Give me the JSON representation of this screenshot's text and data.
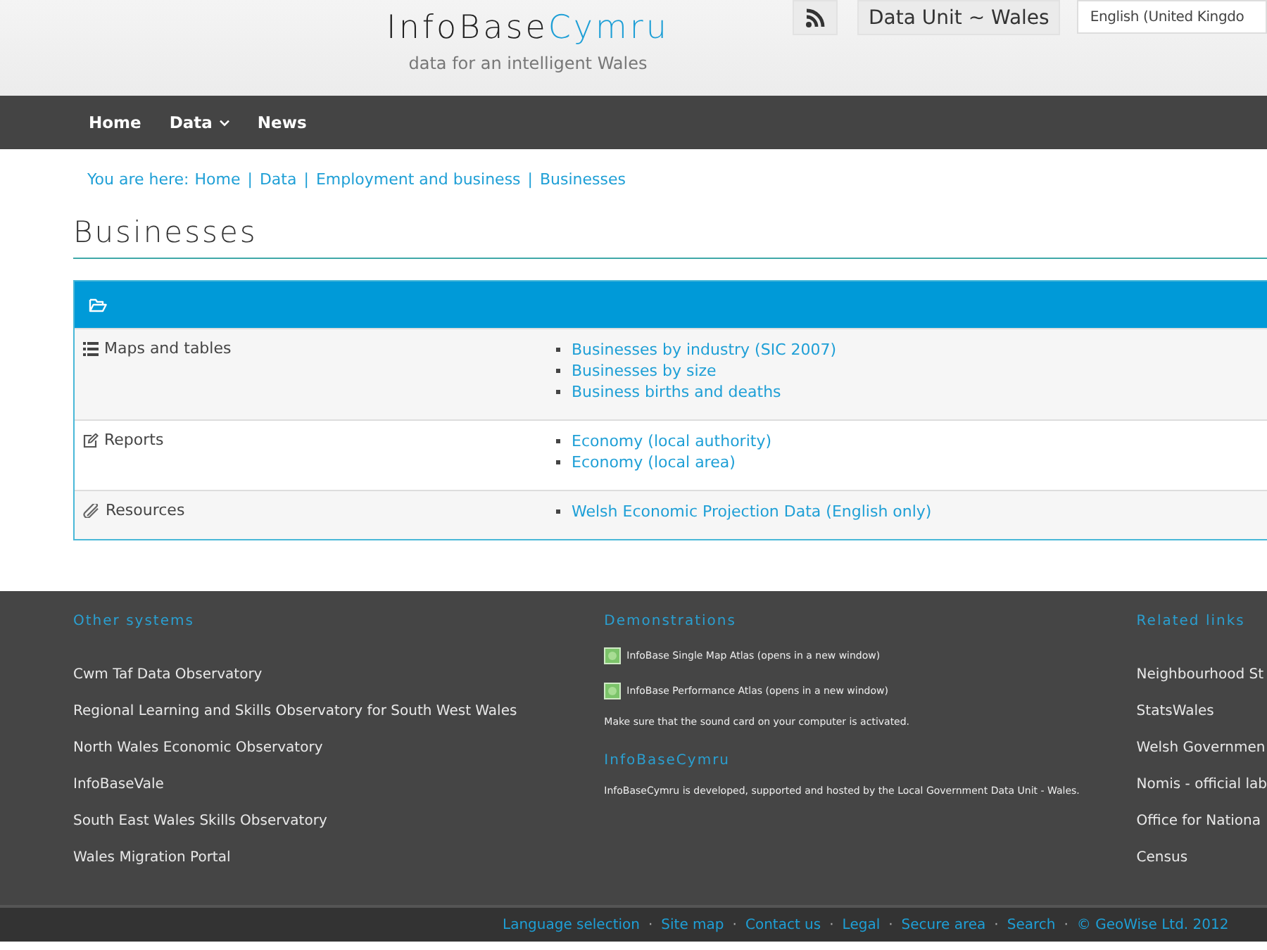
{
  "header": {
    "logo": {
      "part1": "InfoBase",
      "part2": "Cymru"
    },
    "tagline": "data for an intelligent Wales",
    "org": "Data Unit ~ Wales",
    "language": "English (United Kingdo"
  },
  "nav": [
    {
      "label": "Home",
      "dropdown": false
    },
    {
      "label": "Data",
      "dropdown": true
    },
    {
      "label": "News",
      "dropdown": false
    }
  ],
  "breadcrumb": {
    "prefix": "You are here:",
    "items": [
      "Home",
      "Data",
      "Employment and business",
      "Businesses"
    ],
    "separator": "|"
  },
  "title": "Businesses",
  "panel": {
    "rows": [
      {
        "kind": "list",
        "label": "Maps and tables",
        "links": [
          "Businesses by industry (SIC 2007)",
          "Businesses by size",
          "Business births and deaths"
        ]
      },
      {
        "kind": "edit",
        "label": "Reports",
        "links": [
          "Economy (local authority)",
          "Economy (local area)"
        ]
      },
      {
        "kind": "clip",
        "label": "Resources",
        "links": [
          "Welsh Economic Projection Data (English only)"
        ]
      }
    ]
  },
  "footer": {
    "other": {
      "heading": "Other systems",
      "links": [
        "Cwm Taf Data Observatory",
        "Regional Learning and Skills Observatory for South West Wales",
        "North Wales Economic Observatory",
        "InfoBaseVale",
        "South East Wales Skills Observatory",
        "Wales Migration Portal"
      ]
    },
    "demos": {
      "heading": "Demonstrations",
      "items": [
        "InfoBase Single Map Atlas (opens in a new window)",
        "InfoBase Performance Atlas (opens in a new window)"
      ],
      "note": "Make sure that the sound card on your computer is activated.",
      "about_heading": "InfoBaseCymru",
      "about": "InfoBaseCymru is developed, supported and hosted by the Local Government Data Unit - Wales."
    },
    "related": {
      "heading": "Related links",
      "links": [
        "Neighbourhood St",
        "StatsWales",
        "Welsh Governmen",
        "Nomis - official lab",
        "Office for Nationa",
        "Census"
      ]
    }
  },
  "bottom": {
    "links": [
      "Language selection",
      "Site map",
      "Contact us",
      "Legal",
      "Secure area",
      "Search",
      "© GeoWise Ltd. 2012"
    ],
    "separator": "·"
  }
}
